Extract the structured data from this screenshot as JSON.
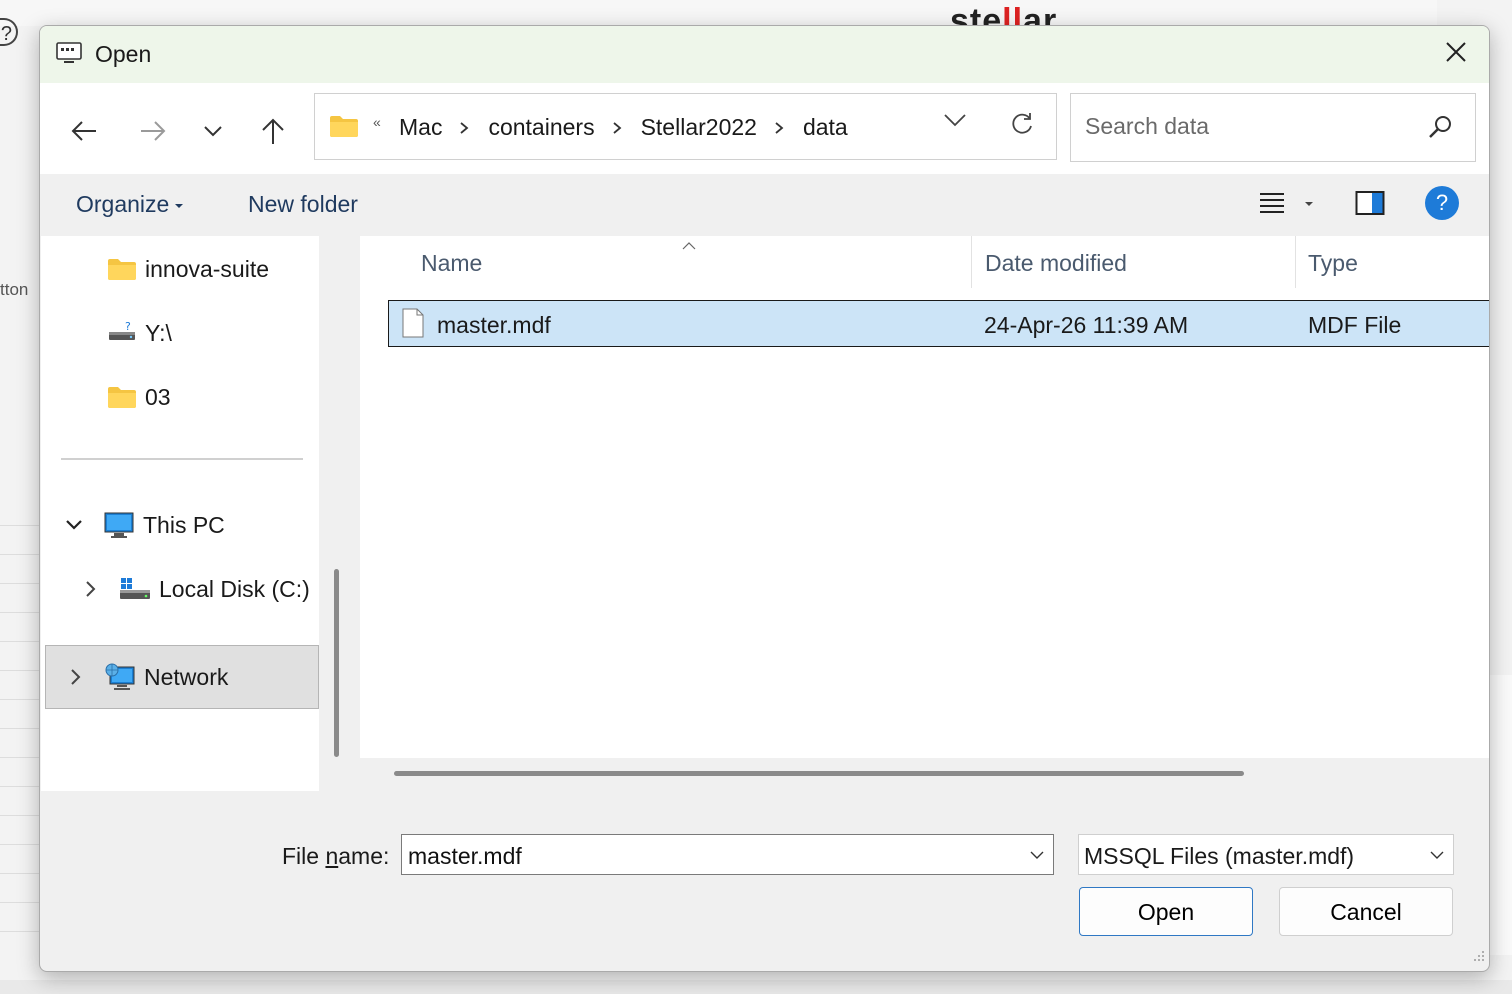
{
  "background": {
    "brand_prefix": "ste",
    "brand_red": "ll",
    "brand_suffix": "ar",
    "help_glyph": "?",
    "left_fragment": "tton"
  },
  "dialog": {
    "title": "Open",
    "close_icon": "close-icon"
  },
  "nav": {
    "back_icon": "arrow-left-icon",
    "forward_icon": "arrow-right-icon",
    "recent_icon": "chevron-down-icon",
    "up_icon": "arrow-up-icon"
  },
  "address": {
    "overflow": "«",
    "crumbs": [
      "Mac",
      "containers",
      "Stellar2022",
      "data"
    ]
  },
  "search": {
    "placeholder": "Search data"
  },
  "toolbar": {
    "organize_label": "Organize",
    "new_folder_label": "New folder",
    "help_glyph": "?"
  },
  "sidebar": {
    "items": [
      {
        "label": "innova-suite"
      },
      {
        "label": "Y:\\"
      },
      {
        "label": "03"
      },
      {
        "label": "This PC"
      },
      {
        "label": "Local Disk (C:)"
      },
      {
        "label": "Network"
      }
    ]
  },
  "filelist": {
    "columns": [
      "Name",
      "Date modified",
      "Type"
    ],
    "rows": [
      {
        "name": "master.mdf",
        "date": "24-Apr-26 11:39 AM",
        "type": "MDF File"
      }
    ]
  },
  "footer": {
    "filename_label_pre": "File ",
    "filename_label_ul": "n",
    "filename_label_post": "ame:",
    "filename_value": "master.mdf",
    "filetype_value": "MSSQL Files (master.mdf)",
    "open_label": "Open",
    "cancel_label": "Cancel"
  },
  "colors": {
    "accent": "#1e7bd8",
    "selection": "#cce4f7",
    "titlebar": "#eef6ea",
    "folder": "#f5c542"
  }
}
